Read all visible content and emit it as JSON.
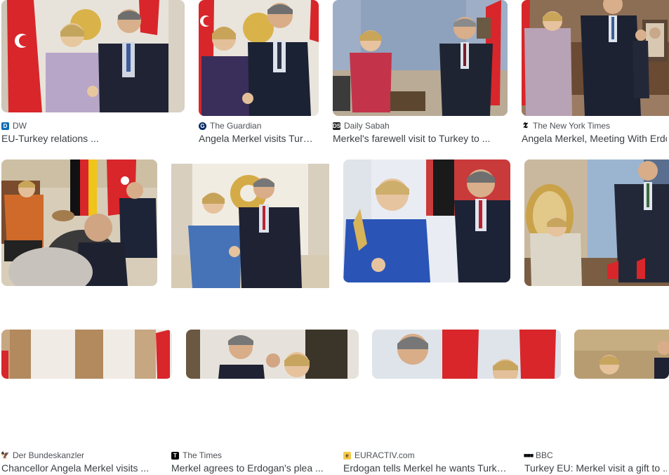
{
  "results": [
    {
      "source": "DW",
      "title": "EU-Turkey relations ...",
      "icon": "dw-favicon"
    },
    {
      "source": "The Guardian",
      "title": "Angela Merkel visits Turkey ...",
      "icon": "guardian-favicon"
    },
    {
      "source": "Daily Sabah",
      "title": "Merkel's farewell visit to Turkey to ...",
      "icon": "dailysabah-favicon"
    },
    {
      "source": "The New York Times",
      "title": "Angela Merkel, Meeting With Erdogan ...",
      "icon": "nyt-favicon"
    },
    {
      "source": "Der Bundeskanzler",
      "title": "Chancellor Angela Merkel visits ...",
      "icon": "bundeskanzler-favicon"
    },
    {
      "source": "The Times",
      "title": "Merkel agrees to Erdogan's plea ...",
      "icon": "thetimes-favicon"
    },
    {
      "source": "EURACTIV.com",
      "title": "Erdogan tells Merkel he wants Turkey ...",
      "icon": "euractiv-favicon"
    },
    {
      "source": "BBC",
      "title": "Turkey EU: Merkel visit a gift to ...",
      "icon": "bbc-favicon"
    },
    {
      "source": "",
      "title": "",
      "icon": ""
    },
    {
      "source": "",
      "title": "",
      "icon": ""
    },
    {
      "source": "",
      "title": "",
      "icon": ""
    },
    {
      "source": "",
      "title": "",
      "icon": ""
    }
  ]
}
